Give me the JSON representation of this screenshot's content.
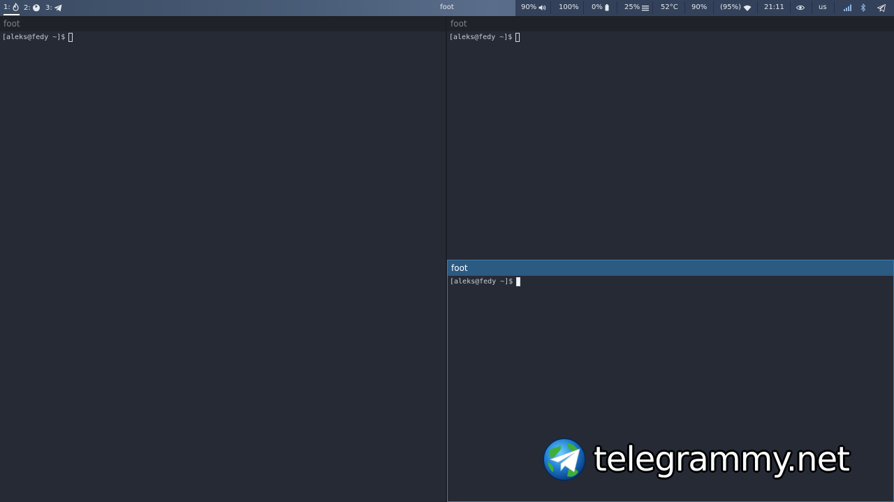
{
  "bar": {
    "workspaces": [
      {
        "label": "1:",
        "icon": "fire-icon",
        "active": true
      },
      {
        "label": "2:",
        "icon": "firefox-icon",
        "active": false
      },
      {
        "label": "3:",
        "icon": "telegram-icon",
        "active": false
      }
    ],
    "title": "foot",
    "modules": {
      "volume": "90%",
      "brightness": "100%",
      "battery": "0%",
      "cpu": "25%",
      "temperature": "52°C",
      "memory": "90%",
      "wifi": "(95%)",
      "clock": "21:11",
      "layout": "us"
    }
  },
  "windows": {
    "left": {
      "title": "foot",
      "prompt": "[aleks@fedy ~]$"
    },
    "top_right": {
      "title": "foot",
      "prompt": "[aleks@fedy ~]$"
    },
    "bottom_right": {
      "title": "foot",
      "prompt": "[aleks@fedy ~]$"
    }
  },
  "watermark": {
    "text": "telegrammy.net"
  },
  "colors": {
    "background": "#262a35",
    "focused_title": "#2b5a82",
    "focused_border": "#3f7aa6",
    "bar": "#4a5d78"
  }
}
